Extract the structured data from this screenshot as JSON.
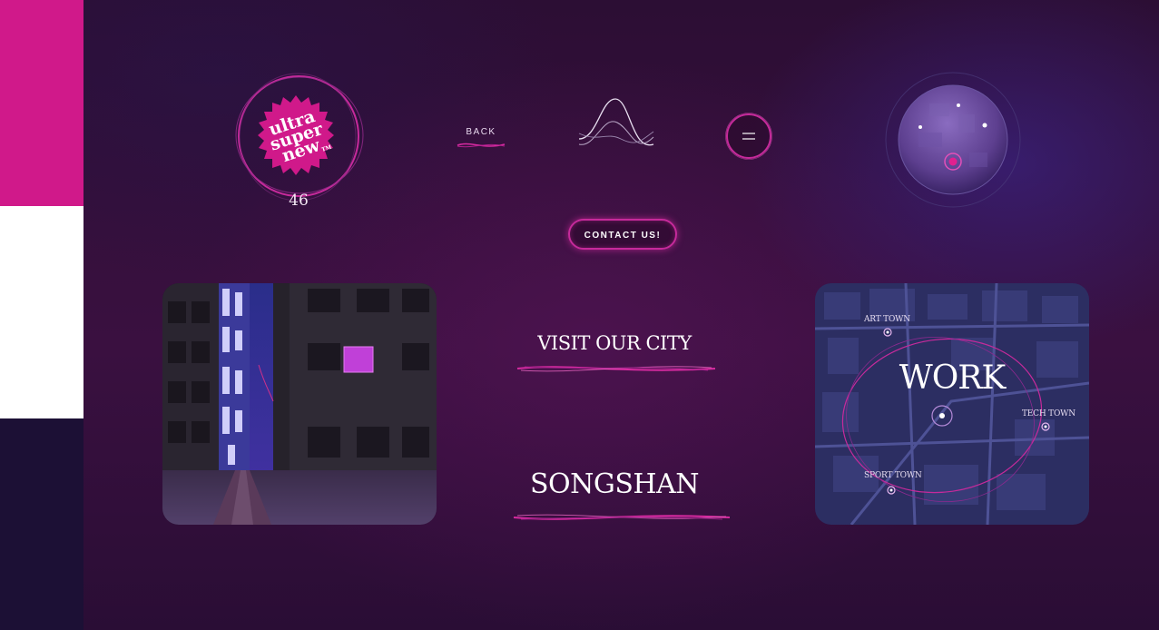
{
  "logo": {
    "brand_text": [
      "ultra",
      "super",
      "new"
    ],
    "trademark": "TM",
    "count": "46",
    "brand_color": "#d0198a"
  },
  "nav": {
    "back_label": "BACK",
    "contact_label": "CONTACT US!",
    "menu_icon": "menu-icon",
    "wave_icon": "wave-icon"
  },
  "sections": {
    "visit_label": "VISIT OUR CITY",
    "songshan_label": "SONGSHAN"
  },
  "work_map": {
    "title": "WORK",
    "towns": [
      "ART TOWN",
      "TECH TOWN",
      "SPORT TOWN"
    ]
  },
  "colors": {
    "accent": "#d62aa0",
    "background": "#2a0f35",
    "strip_pink": "#d0198a",
    "strip_white": "#ffffff",
    "strip_navy": "#1c1035"
  }
}
